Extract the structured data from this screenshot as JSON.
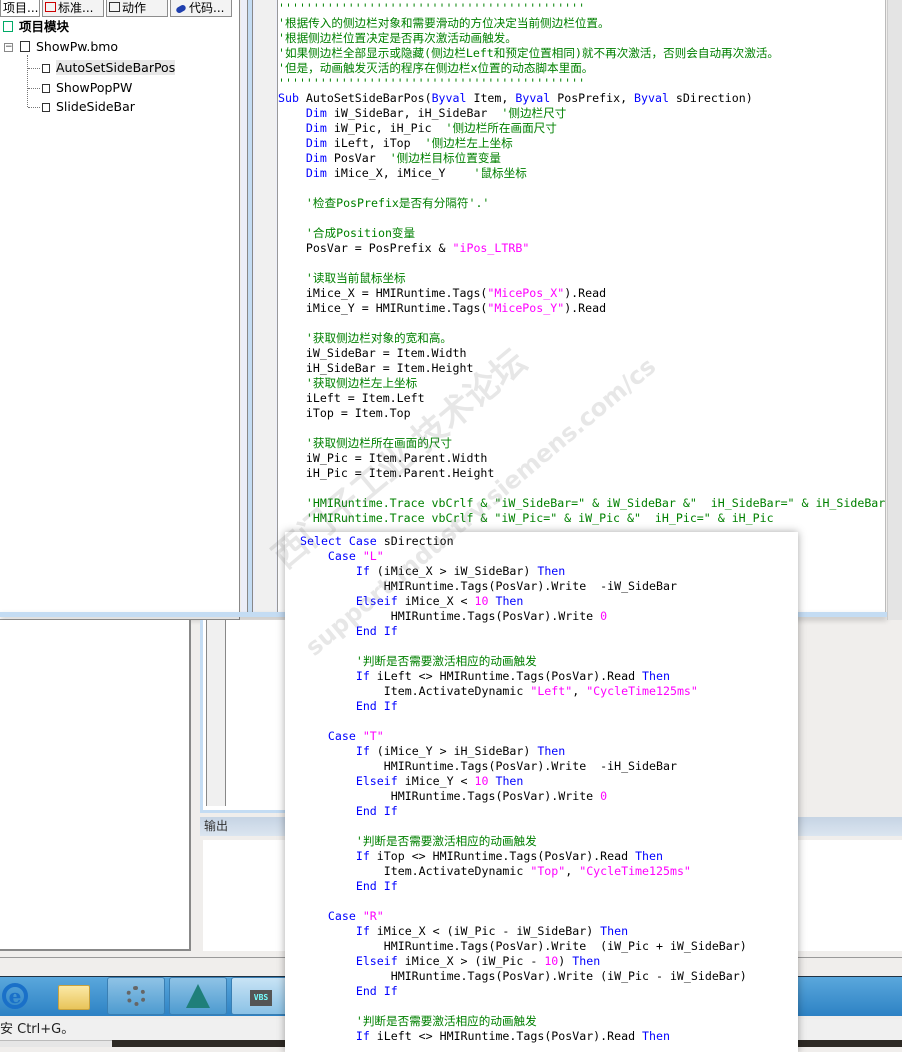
{
  "tabs": [
    {
      "label": "项目...",
      "icon": "project-icon"
    },
    {
      "label": "标准...",
      "icon": "standard-icon"
    },
    {
      "label": "动作",
      "icon": "action-icon"
    },
    {
      "label": "代码...",
      "icon": "code-icon"
    }
  ],
  "tree": {
    "root": "项目模块",
    "file": "ShowPw.bmo",
    "items": [
      "AutoSetSideBarPos",
      "ShowPopPW",
      "SlideSideBar"
    ],
    "selected": "AutoSetSideBarPos"
  },
  "output_panel": {
    "title": "输出"
  },
  "status_bar": {
    "text": "安 Ctrl+G。"
  },
  "taskbar": {
    "icons": [
      "internet-explorer-icon",
      "file-explorer-icon",
      "wincc-runtime-icon",
      "wincc-designer-icon",
      "vbs-editor-icon"
    ],
    "vbs_label": "VBS"
  },
  "watermark": {
    "text": "西门子工业 技术论坛",
    "url": "support.industry.siemens.com/cs"
  },
  "colors": {
    "keyword": "#0000ff",
    "comment": "#008000",
    "string": "#ff00ff",
    "selection": "#e8e8e8",
    "taskbar": "#3d8fcc"
  },
  "editor_code": [
    [
      [
        "c",
        "''''''''''''''''''''''''''''''''''''''''''''"
      ]
    ],
    [
      [
        "c",
        "'根据传入的侧边栏对象和需要滑动的方位决定当前侧边栏位置。"
      ]
    ],
    [
      [
        "c",
        "'根据侧边栏位置决定是否再次激活动画触发。"
      ]
    ],
    [
      [
        "c",
        "'如果侧边栏全部显示或隐藏(侧边栏Left和预定位置相同)就不再次激活，否则会自动再次激活。"
      ]
    ],
    [
      [
        "c",
        "'但是，动画触发灭活的程序在侧边栏x位置的动态脚本里面。"
      ]
    ],
    [
      [
        "c",
        "''''''''''''''''''''''''''''''''''''''''''''"
      ]
    ],
    [
      [
        "k",
        "Sub"
      ],
      [
        "p",
        " AutoSetSideBarPos("
      ],
      [
        "k",
        "Byval"
      ],
      [
        "p",
        " Item, "
      ],
      [
        "k",
        "Byval"
      ],
      [
        "p",
        " PosPrefix, "
      ],
      [
        "k",
        "Byval"
      ],
      [
        "p",
        " sDirection)"
      ]
    ],
    [
      [
        "p",
        "    "
      ],
      [
        "k",
        "Dim"
      ],
      [
        "p",
        " iW_SideBar, iH_SideBar  "
      ],
      [
        "c",
        "'侧边栏尺寸"
      ]
    ],
    [
      [
        "p",
        "    "
      ],
      [
        "k",
        "Dim"
      ],
      [
        "p",
        " iW_Pic, iH_Pic  "
      ],
      [
        "c",
        "'侧边栏所在画面尺寸"
      ]
    ],
    [
      [
        "p",
        "    "
      ],
      [
        "k",
        "Dim"
      ],
      [
        "p",
        " iLeft, iTop  "
      ],
      [
        "c",
        "'侧边栏左上坐标"
      ]
    ],
    [
      [
        "p",
        "    "
      ],
      [
        "k",
        "Dim"
      ],
      [
        "p",
        " PosVar  "
      ],
      [
        "c",
        "'侧边栏目标位置变量"
      ]
    ],
    [
      [
        "p",
        "    "
      ],
      [
        "k",
        "Dim"
      ],
      [
        "p",
        " iMice_X, iMice_Y    "
      ],
      [
        "c",
        "'鼠标坐标"
      ]
    ],
    [],
    [
      [
        "p",
        "    "
      ],
      [
        "c",
        "'检查PosPrefix是否有分隔符'.'"
      ]
    ],
    [],
    [
      [
        "p",
        "    "
      ],
      [
        "c",
        "'合成Position变量"
      ]
    ],
    [
      [
        "p",
        "    PosVar = PosPrefix & "
      ],
      [
        "s",
        "\"iPos_LTRB\""
      ]
    ],
    [],
    [
      [
        "p",
        "    "
      ],
      [
        "c",
        "'读取当前鼠标坐标"
      ]
    ],
    [
      [
        "p",
        "    iMice_X = HMIRuntime.Tags("
      ],
      [
        "s",
        "\"MicePos_X\""
      ],
      [
        "p",
        ").Read"
      ]
    ],
    [
      [
        "p",
        "    iMice_Y = HMIRuntime.Tags("
      ],
      [
        "s",
        "\"MicePos_Y\""
      ],
      [
        "p",
        ").Read"
      ]
    ],
    [],
    [
      [
        "p",
        "    "
      ],
      [
        "c",
        "'获取侧边栏对象的宽和高。"
      ]
    ],
    [
      [
        "p",
        "    iW_SideBar = Item.Width"
      ]
    ],
    [
      [
        "p",
        "    iH_SideBar = Item.Height"
      ]
    ],
    [
      [
        "p",
        "    "
      ],
      [
        "c",
        "'获取侧边栏左上坐标"
      ]
    ],
    [
      [
        "p",
        "    iLeft = Item.Left"
      ]
    ],
    [
      [
        "p",
        "    iTop = Item.Top"
      ]
    ],
    [],
    [
      [
        "p",
        "    "
      ],
      [
        "c",
        "'获取侧边栏所在画面的尺寸"
      ]
    ],
    [
      [
        "p",
        "    iW_Pic = Item.Parent.Width"
      ]
    ],
    [
      [
        "p",
        "    iH_Pic = Item.Parent.Height"
      ]
    ],
    [],
    [
      [
        "p",
        "    "
      ],
      [
        "c",
        "'HMIRuntime.Trace vbCrlf & \"iW_SideBar=\" & iW_SideBar &\"  iH_SideBar=\" & iH_SideBar"
      ]
    ],
    [
      [
        "p",
        "    "
      ],
      [
        "c",
        "'HMIRuntime.Trace vbCrlf & \"iW_Pic=\" & iW_Pic &\"  iH_Pic=\" & iH_Pic"
      ]
    ]
  ],
  "popup_code": [
    [
      [
        "k",
        "Select Case"
      ],
      [
        "p",
        " sDirection"
      ]
    ],
    [
      [
        "p",
        "    "
      ],
      [
        "k",
        "Case"
      ],
      [
        "p",
        " "
      ],
      [
        "s",
        "\"L\""
      ]
    ],
    [
      [
        "p",
        "        "
      ],
      [
        "k",
        "If"
      ],
      [
        "p",
        " (iMice_X > iW_SideBar) "
      ],
      [
        "k",
        "Then"
      ]
    ],
    [
      [
        "p",
        "            HMIRuntime.Tags(PosVar).Write  -iW_SideBar"
      ]
    ],
    [
      [
        "p",
        "        "
      ],
      [
        "k",
        "Elseif"
      ],
      [
        "p",
        " iMice_X < "
      ],
      [
        "n",
        "10"
      ],
      [
        "p",
        " "
      ],
      [
        "k",
        "Then"
      ]
    ],
    [
      [
        "p",
        "             HMIRuntime.Tags(PosVar).Write "
      ],
      [
        "n",
        "0"
      ]
    ],
    [
      [
        "p",
        "        "
      ],
      [
        "k",
        "End If"
      ]
    ],
    [],
    [
      [
        "p",
        "        "
      ],
      [
        "c",
        "'判断是否需要激活相应的动画触发"
      ]
    ],
    [
      [
        "p",
        "        "
      ],
      [
        "k",
        "If"
      ],
      [
        "p",
        " iLeft <> HMIRuntime.Tags(PosVar).Read "
      ],
      [
        "k",
        "Then"
      ]
    ],
    [
      [
        "p",
        "            Item.ActivateDynamic "
      ],
      [
        "s",
        "\"Left\""
      ],
      [
        "p",
        ", "
      ],
      [
        "s",
        "\"CycleTime125ms\""
      ]
    ],
    [
      [
        "p",
        "        "
      ],
      [
        "k",
        "End If"
      ]
    ],
    [],
    [
      [
        "p",
        "    "
      ],
      [
        "k",
        "Case"
      ],
      [
        "p",
        " "
      ],
      [
        "s",
        "\"T\""
      ]
    ],
    [
      [
        "p",
        "        "
      ],
      [
        "k",
        "If"
      ],
      [
        "p",
        " (iMice_Y > iH_SideBar) "
      ],
      [
        "k",
        "Then"
      ]
    ],
    [
      [
        "p",
        "            HMIRuntime.Tags(PosVar).Write  -iH_SideBar"
      ]
    ],
    [
      [
        "p",
        "        "
      ],
      [
        "k",
        "Elseif"
      ],
      [
        "p",
        " iMice_Y < "
      ],
      [
        "n",
        "10"
      ],
      [
        "p",
        " "
      ],
      [
        "k",
        "Then"
      ]
    ],
    [
      [
        "p",
        "             HMIRuntime.Tags(PosVar).Write "
      ],
      [
        "n",
        "0"
      ]
    ],
    [
      [
        "p",
        "        "
      ],
      [
        "k",
        "End If"
      ]
    ],
    [],
    [
      [
        "p",
        "        "
      ],
      [
        "c",
        "'判断是否需要激活相应的动画触发"
      ]
    ],
    [
      [
        "p",
        "        "
      ],
      [
        "k",
        "If"
      ],
      [
        "p",
        " iTop <> HMIRuntime.Tags(PosVar).Read "
      ],
      [
        "k",
        "Then"
      ]
    ],
    [
      [
        "p",
        "            Item.ActivateDynamic "
      ],
      [
        "s",
        "\"Top\""
      ],
      [
        "p",
        ", "
      ],
      [
        "s",
        "\"CycleTime125ms\""
      ]
    ],
    [
      [
        "p",
        "        "
      ],
      [
        "k",
        "End If"
      ]
    ],
    [],
    [
      [
        "p",
        "    "
      ],
      [
        "k",
        "Case"
      ],
      [
        "p",
        " "
      ],
      [
        "s",
        "\"R\""
      ]
    ],
    [
      [
        "p",
        "        "
      ],
      [
        "k",
        "If"
      ],
      [
        "p",
        " iMice_X < (iW_Pic - iW_SideBar) "
      ],
      [
        "k",
        "Then"
      ]
    ],
    [
      [
        "p",
        "            HMIRuntime.Tags(PosVar).Write  (iW_Pic + iW_SideBar)"
      ]
    ],
    [
      [
        "p",
        "        "
      ],
      [
        "k",
        "Elseif"
      ],
      [
        "p",
        " iMice_X > (iW_Pic - "
      ],
      [
        "n",
        "10"
      ],
      [
        "p",
        ") "
      ],
      [
        "k",
        "Then"
      ]
    ],
    [
      [
        "p",
        "             HMIRuntime.Tags(PosVar).Write (iW_Pic - iW_SideBar)"
      ]
    ],
    [
      [
        "p",
        "        "
      ],
      [
        "k",
        "End If"
      ]
    ],
    [],
    [
      [
        "p",
        "        "
      ],
      [
        "c",
        "'判断是否需要激活相应的动画触发"
      ]
    ],
    [
      [
        "p",
        "        "
      ],
      [
        "k",
        "If"
      ],
      [
        "p",
        " iLeft <> HMIRuntime.Tags(PosVar).Read "
      ],
      [
        "k",
        "Then"
      ]
    ]
  ]
}
